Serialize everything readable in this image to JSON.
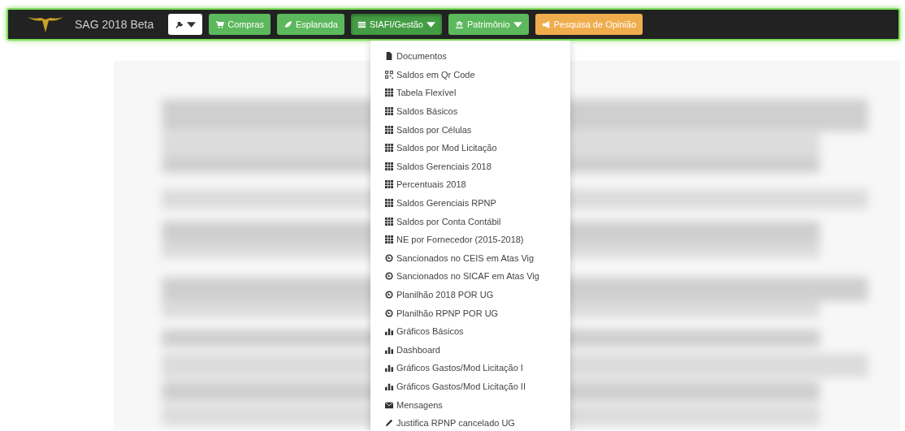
{
  "navbar": {
    "brand": "SAG 2018 Beta",
    "buttons": [
      {
        "kind": "tool",
        "caret": true,
        "selected": false,
        "color": "#ffffff"
      },
      {
        "kind": "cart",
        "label": "Compras",
        "caret": false,
        "selected": false,
        "color": "#5cb85c"
      },
      {
        "kind": "leaf",
        "label": "Esplanada",
        "caret": false,
        "selected": false,
        "color": "#5cb85c"
      },
      {
        "kind": "table",
        "label": "SIAFI/Gestão",
        "caret": true,
        "selected": true,
        "color": "#449d44"
      },
      {
        "kind": "bank",
        "label": "Patrimônio",
        "caret": true,
        "selected": false,
        "color": "#5cb85c"
      },
      {
        "kind": "bullhorn",
        "label": "Pesquisa de Opinião",
        "caret": false,
        "selected": false,
        "color": "#f0ad4e"
      }
    ]
  },
  "dropdown": {
    "items": [
      {
        "kind": "file",
        "label": "Documentos"
      },
      {
        "kind": "qrcode",
        "label": "Saldos em Qr Code"
      },
      {
        "kind": "grid",
        "label": "Tabela Flexível"
      },
      {
        "kind": "grid",
        "label": "Saldos Básicos"
      },
      {
        "kind": "grid",
        "label": "Saldos por Células"
      },
      {
        "kind": "grid",
        "label": "Saldos por Mod Licitação"
      },
      {
        "kind": "grid",
        "label": "Saldos Gerenciais 2018"
      },
      {
        "kind": "grid",
        "label": "Percentuais 2018"
      },
      {
        "kind": "grid",
        "label": "Saldos Gerenciais RPNP"
      },
      {
        "kind": "grid",
        "label": "Saldos por Conta Contábil"
      },
      {
        "kind": "grid",
        "label": "NE por Fornecedor (2015-2018)"
      },
      {
        "kind": "circle",
        "label": "Sancionados no CEIS em Atas Vig"
      },
      {
        "kind": "circle",
        "label": "Sancionados no SICAF em Atas Vig"
      },
      {
        "kind": "circle",
        "label": "Planilhão 2018 POR UG"
      },
      {
        "kind": "circle",
        "label": "Planilhão RPNP POR UG"
      },
      {
        "kind": "chart",
        "label": "Gráficos Básicos"
      },
      {
        "kind": "chart",
        "label": "Dashboard"
      },
      {
        "kind": "chart",
        "label": "Gráficos Gastos/Mod Licitação I"
      },
      {
        "kind": "chart",
        "label": "Gráficos Gastos/Mod Licitação II"
      },
      {
        "kind": "envelope",
        "label": "Mensagens"
      },
      {
        "kind": "pencil",
        "label": "Justifica RPNP cancelado UG"
      }
    ]
  }
}
